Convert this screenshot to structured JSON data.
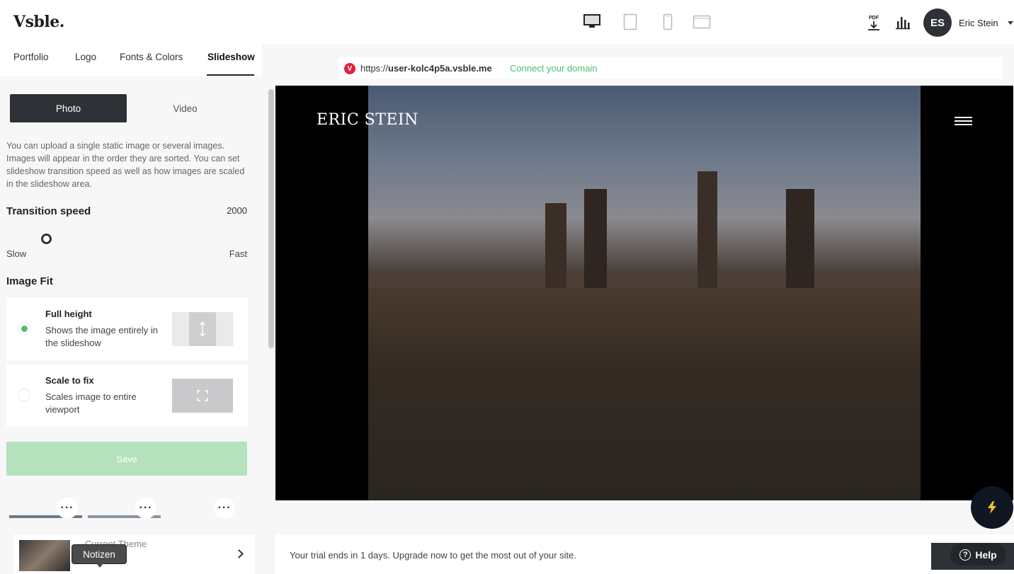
{
  "header": {
    "logo": "Vsble.",
    "devices": [
      "desktop-icon",
      "tablet-icon",
      "phone-icon",
      "laptop-icon"
    ],
    "pdf_label": "PDF",
    "avatar_initials": "ES",
    "user_name": "Eric Stein"
  },
  "tabs": [
    {
      "label": "Portfolio"
    },
    {
      "label": "Logo"
    },
    {
      "label": "Fonts & Colors"
    },
    {
      "label": "Slideshow",
      "active": true
    }
  ],
  "panel": {
    "photo_label": "Photo",
    "video_label": "Video",
    "description": "You can upload a single static image or several images. Images will appear in the order they are sorted. You can set slideshow transition speed as well as how images are scaled in the slideshow area.",
    "transition_title": "Transition speed",
    "transition_value": "2000",
    "slider_min_label": "Slow",
    "slider_max_label": "Fast",
    "image_fit_title": "Image Fit",
    "fit_options": [
      {
        "title": "Full height",
        "desc": "Shows the image entirely in the slideshow",
        "selected": true
      },
      {
        "title": "Scale to fix",
        "desc": "Scales image to entire viewport",
        "selected": false
      }
    ],
    "save_label": "Save",
    "theme_label": "Current Theme",
    "tooltip": "Notizen"
  },
  "urlbar": {
    "url_prefix": "https://",
    "url_domain": "user-kolc4p5a.vsble.me",
    "connect_label": "Connect your domain"
  },
  "preview": {
    "site_title": "ERIC STEIN"
  },
  "trial": {
    "text": "Your trial ends in 1 days. Upgrade now to get the most out of your site."
  },
  "help_label": "Help",
  "colors": {
    "accent_green": "#4cc069",
    "dark": "#2e3237",
    "save_disabled": "#b3e2bd"
  }
}
